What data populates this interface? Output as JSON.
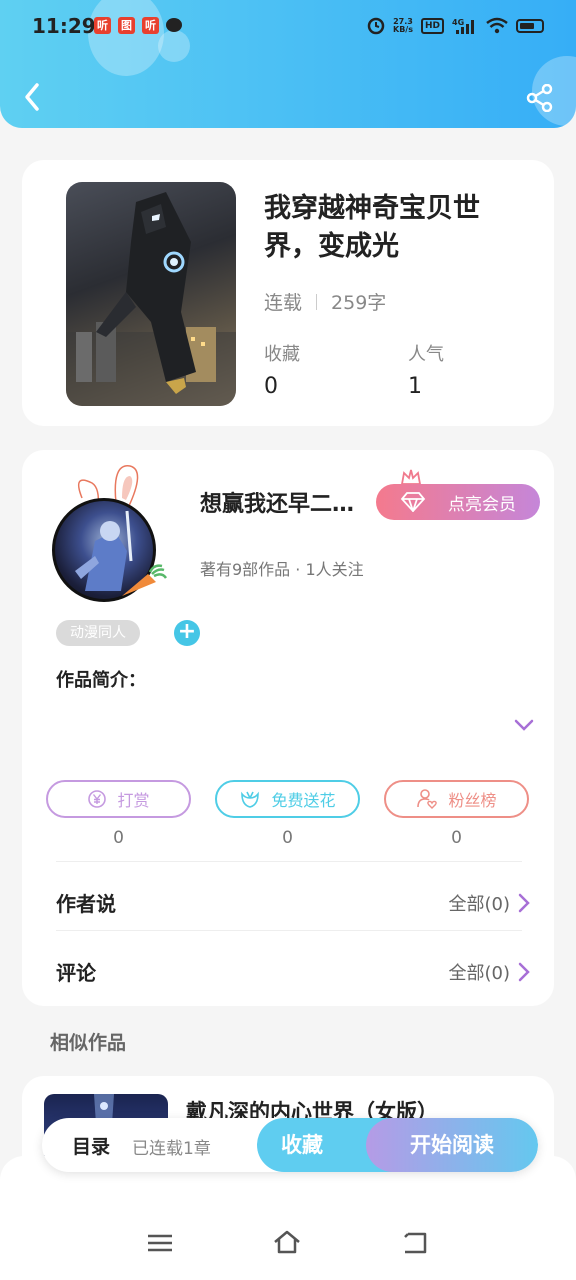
{
  "status_bar": {
    "time": "11:29",
    "notif_icons": [
      "听",
      "图",
      "听"
    ],
    "net_speed_value": "27.3",
    "net_speed_unit": "KB/s",
    "hd": "HD",
    "signal": "4G"
  },
  "book": {
    "title": "我穿越神奇宝贝世界，变成光",
    "status": "连载",
    "words": "259字",
    "favorites_label": "收藏",
    "favorites_value": "0",
    "popularity_label": "人气",
    "popularity_value": "1"
  },
  "author": {
    "name": "想赢我还早二…",
    "vip_label": "点亮会员",
    "stats": "著有9部作品 · 1人关注",
    "tag": "动漫同人",
    "intro_label": "作品简介："
  },
  "actions": [
    {
      "label": "打赏",
      "count": "0",
      "color": "#c59ae0"
    },
    {
      "label": "免费送花",
      "count": "0",
      "color": "#4fcde6"
    },
    {
      "label": "粉丝榜",
      "count": "0",
      "color": "#ee8f87"
    }
  ],
  "rows": {
    "author_says_label": "作者说",
    "author_says_value": "全部(0)",
    "comments_label": "评论",
    "comments_value": "全部(0)"
  },
  "similar": {
    "section_title": "相似作品",
    "item_title": "戴凡深的内心世界（女版）"
  },
  "bottom_bar": {
    "toc": "目录",
    "chapters": "已连载1章",
    "favorite": "收藏",
    "read": "开始阅读"
  },
  "colors": {
    "header_start": "#5fd0f2",
    "header_end": "#36aef6",
    "accent": "#a76fd6"
  }
}
